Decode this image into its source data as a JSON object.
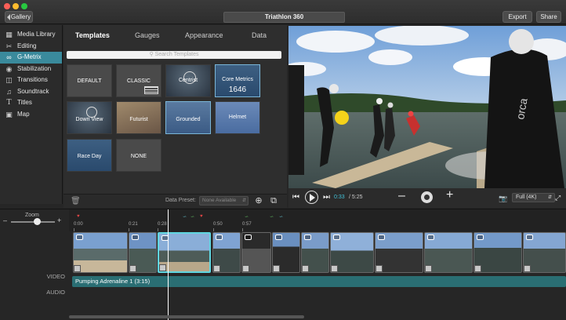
{
  "titlebar": {
    "gallery_label": "Gallery",
    "project_title": "Triathlon 360",
    "export_label": "Export",
    "share_label": "Share"
  },
  "sidebar": {
    "items": [
      {
        "label": "Media Library",
        "icon": "film-icon"
      },
      {
        "label": "Editing",
        "icon": "scissors-icon"
      },
      {
        "label": "G-Metrix",
        "icon": "gmetrix-icon",
        "active": true
      },
      {
        "label": "Stabilization",
        "icon": "stabilization-icon"
      },
      {
        "label": "Transitions",
        "icon": "transitions-icon"
      },
      {
        "label": "Soundtrack",
        "icon": "music-icon"
      },
      {
        "label": "Titles",
        "icon": "text-icon"
      },
      {
        "label": "Map",
        "icon": "map-icon"
      }
    ]
  },
  "templates_panel": {
    "tabs": [
      "Templates",
      "Gauges",
      "Appearance",
      "Data"
    ],
    "search_placeholder": "Search Templates",
    "tiles": [
      "DEFAULT",
      "CLASSIC",
      "Centrist",
      "Core Metrics",
      "Down View",
      "Futurist",
      "Grounded",
      "Helmet",
      "Race Day",
      "NONE"
    ],
    "core_metrics_value": "1646",
    "data_preset_label": "Data Preset:",
    "data_preset_value": "None Available"
  },
  "player": {
    "current_time": "0:33",
    "total_time": "/ 5:25",
    "quality": "Full (4K)"
  },
  "timeline": {
    "zoom_label": "Zoom",
    "video_label": "VIDEO",
    "audio_label": "AUDIO",
    "ticks": [
      "0:00",
      "0:21",
      "0:28",
      "0:50",
      "0:57"
    ],
    "audio_track": "Pumping Adrenaline 1  (3:15)"
  },
  "colors": {
    "accent": "#3a8a9c",
    "selection": "#5fd6e0",
    "audio_track": "#2a6e73",
    "time_current": "#41c2d9"
  }
}
